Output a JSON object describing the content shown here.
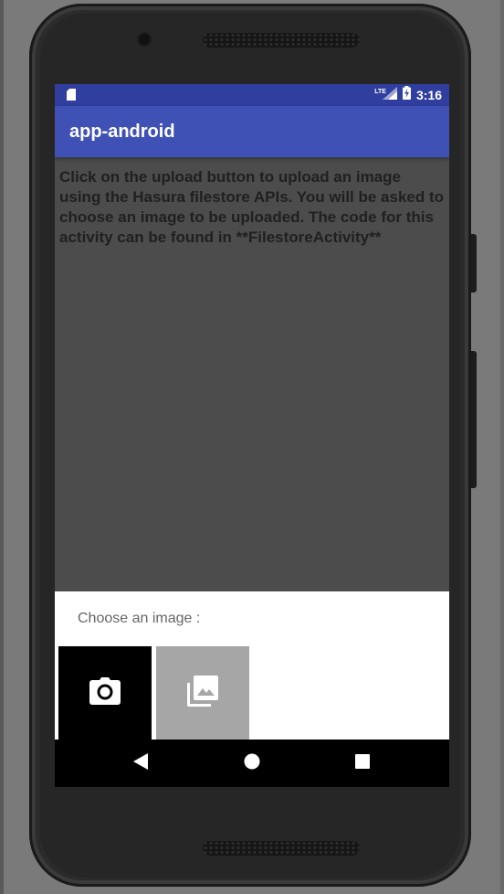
{
  "status_bar": {
    "network": "LTE",
    "time": "3:16"
  },
  "app_bar": {
    "title": "app-android"
  },
  "content": {
    "description": "Click on the upload button to upload an image using the Hasura filestore APIs. You will be asked to choose an image to be uploaded. The code for this activity can be found in **FilestoreActivity**"
  },
  "bottom_sheet": {
    "title": "Choose an image :",
    "options": [
      {
        "icon": "camera-icon"
      },
      {
        "icon": "gallery-icon"
      }
    ]
  },
  "nav_bar": {
    "buttons": [
      "back-icon",
      "home-icon",
      "recents-icon"
    ]
  },
  "colors": {
    "status_bar": "#303f9f",
    "app_bar": "#3f51b5",
    "scrim_content": "#4c4c4c",
    "sheet_background": "#ffffff",
    "camera_tile": "#000000",
    "gallery_tile": "#a6a6a6"
  }
}
